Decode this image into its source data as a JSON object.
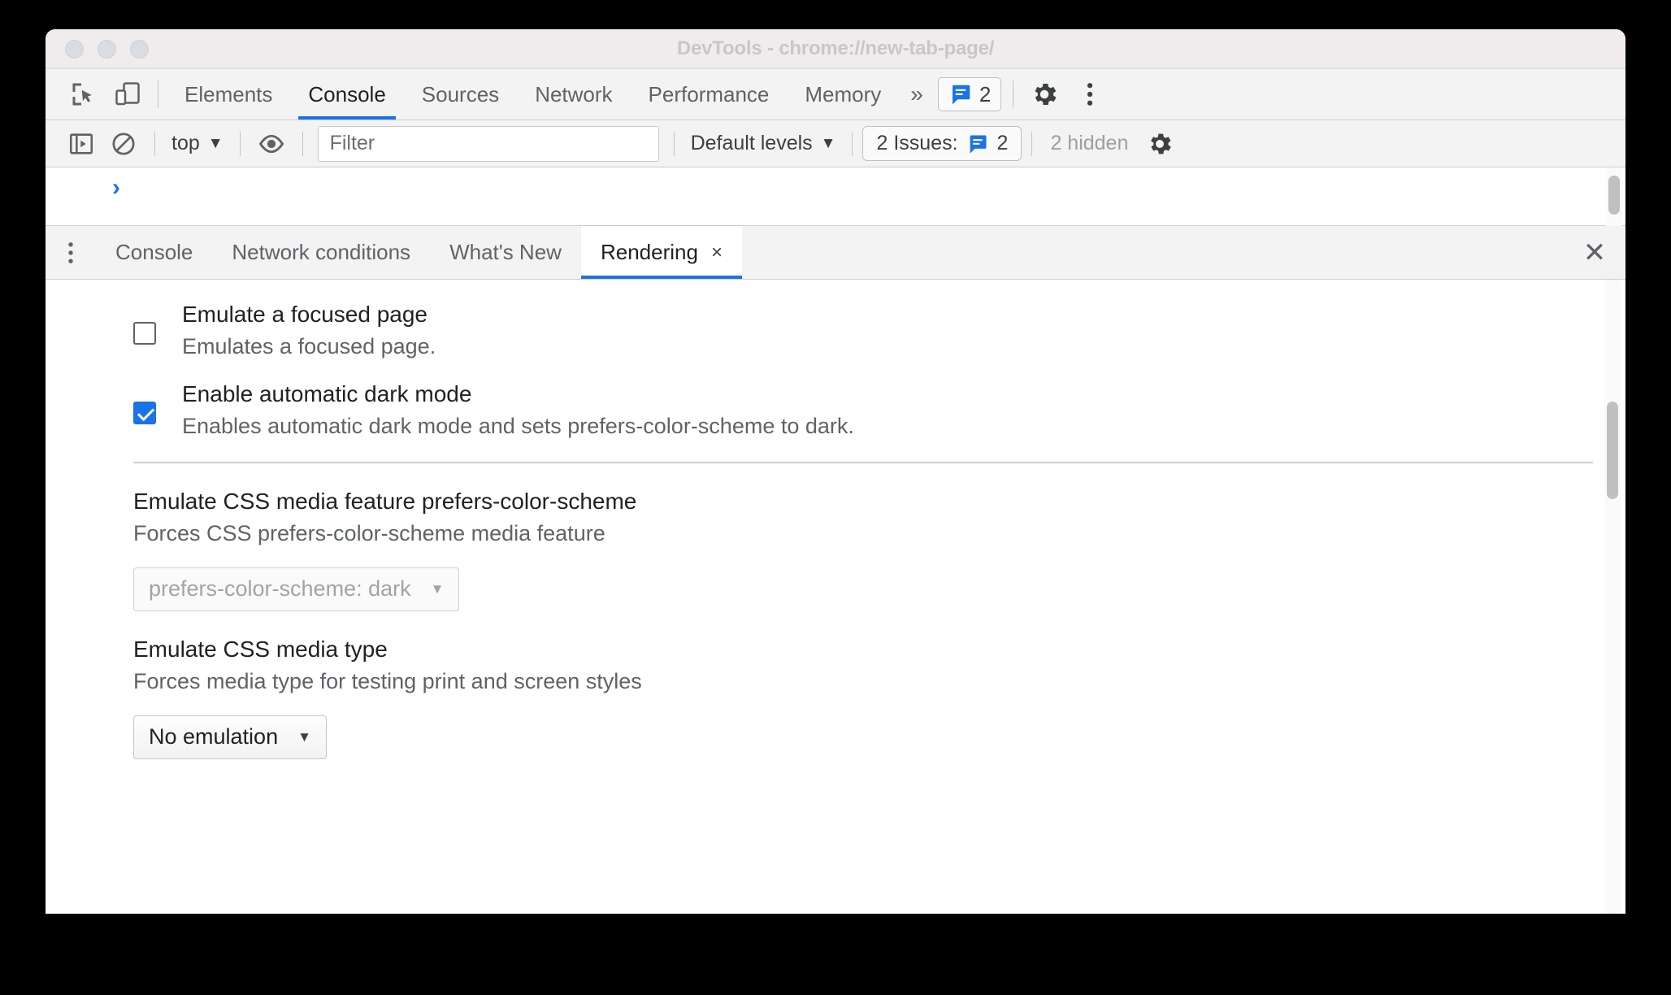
{
  "window": {
    "title": "DevTools - chrome://new-tab-page/",
    "traffic_lights": [
      "close",
      "minimize",
      "maximize"
    ]
  },
  "main_tabbar": {
    "inspect_icon": "inspect-element-icon",
    "device_icon": "device-toolbar-icon",
    "tabs": [
      {
        "label": "Elements",
        "active": false
      },
      {
        "label": "Console",
        "active": true
      },
      {
        "label": "Sources",
        "active": false
      },
      {
        "label": "Network",
        "active": false
      },
      {
        "label": "Performance",
        "active": false
      },
      {
        "label": "Memory",
        "active": false
      }
    ],
    "overflow_label": "»",
    "issues_count": "2",
    "settings_icon": "gear-icon",
    "more_icon": "more-vertical-icon"
  },
  "console_toolbar": {
    "sidebar_toggle_icon": "console-sidebar-icon",
    "clear_icon": "clear-console-icon",
    "context_label": "top",
    "context_caret": "▼",
    "eye_icon": "live-expression-eye-icon",
    "filter_placeholder": "Filter",
    "filter_value": "",
    "levels_label": "Default levels",
    "levels_caret": "▼",
    "issues_label": "2 Issues:",
    "issues_count": "2",
    "hidden_label": "2 hidden",
    "settings_icon": "gear-icon"
  },
  "console_output": {
    "prompt": "›"
  },
  "drawer": {
    "more_icon": "more-vertical-icon",
    "tabs": [
      {
        "label": "Console",
        "active": false,
        "closable": false
      },
      {
        "label": "Network conditions",
        "active": false,
        "closable": false
      },
      {
        "label": "What's New",
        "active": false,
        "closable": false
      },
      {
        "label": "Rendering",
        "active": true,
        "closable": true,
        "close_glyph": "×"
      }
    ],
    "close_glyph": "✕"
  },
  "rendering": {
    "checkbox_settings": [
      {
        "title": "Emulate a focused page",
        "desc": "Emulates a focused page.",
        "checked": false
      },
      {
        "title": "Enable automatic dark mode",
        "desc": "Enables automatic dark mode and sets prefers-color-scheme to dark.",
        "checked": true
      }
    ],
    "select_settings": [
      {
        "title": "Emulate CSS media feature prefers-color-scheme",
        "desc": "Forces CSS prefers-color-scheme media feature",
        "value": "prefers-color-scheme: dark",
        "disabled": true,
        "arrow": "▼"
      },
      {
        "title": "Emulate CSS media type",
        "desc": "Forces media type for testing print and screen styles",
        "value": "No emulation",
        "disabled": false,
        "arrow": "▼"
      }
    ]
  },
  "colors": {
    "accent": "#1a73e8",
    "toolbar_bg": "#f3f3f3",
    "titlebar_bg": "#f0ecee",
    "text_primary": "#202124",
    "text_secondary": "#5f6368",
    "disabled_text": "#a0a4a8"
  }
}
